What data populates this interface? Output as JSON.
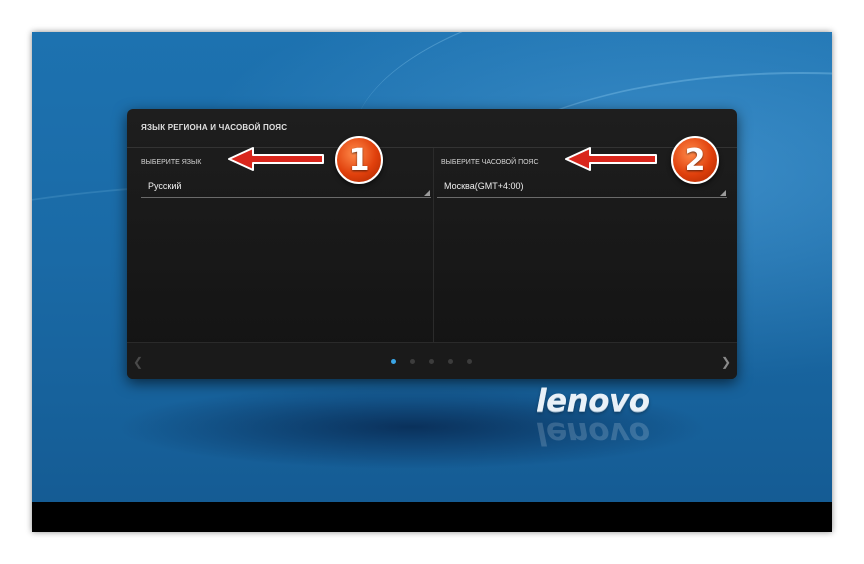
{
  "dialog": {
    "title": "ЯЗЫК РЕГИОНА И ЧАСОВОЙ ПОЯС",
    "language": {
      "label": "ВЫБЕРИТЕ ЯЗЫК",
      "selected": "Русский"
    },
    "timezone": {
      "label": "ВЫБЕРИТЕ ЧАСОВОЙ ПОЯС",
      "selected": "Москва(GMT+4:00)"
    },
    "pager": {
      "prev_icon": "chevron-left-icon",
      "next_icon": "chevron-right-icon",
      "page_count": 5,
      "active_page": 1
    }
  },
  "annotations": {
    "badge_1": "1",
    "badge_2": "2",
    "arrow_color": "#d9261c"
  },
  "brand": {
    "logo_text": "lenovo"
  },
  "colors": {
    "accent_dot": "#3aa5e6",
    "wallpaper": "#1a6aa6"
  }
}
